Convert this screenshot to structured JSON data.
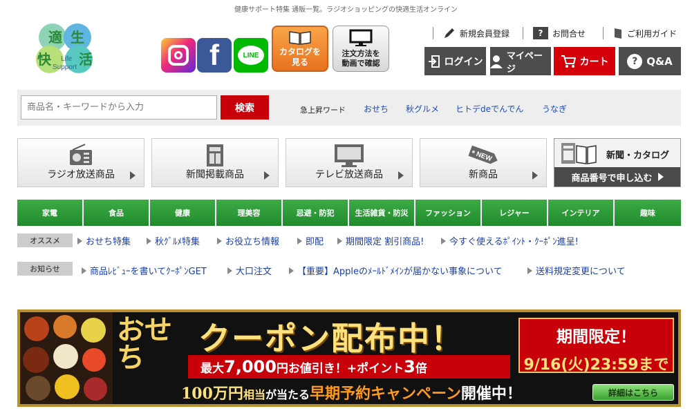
{
  "tagline": "健康サポート特集 通販一覧。ラジオショッピングの快適生活オンライン",
  "logo": {
    "k1": "適",
    "k2": "生",
    "k3": "快",
    "k4": "活",
    "sub1": "Life",
    "sub2": "Support"
  },
  "social": {
    "facebook": "f",
    "line": "LINE"
  },
  "catalog_button": {
    "line1": "カタログを",
    "line2": "見る"
  },
  "order_button": {
    "line1": "注文方法を",
    "line2": "動画で確認"
  },
  "top_links": {
    "register": "新規会員登録",
    "contact": "お問合せ",
    "guide": "ご利用ガイド",
    "help_mark": "?"
  },
  "account_buttons": {
    "login": "ログイン",
    "mypage": "マイページ",
    "cart": "カート",
    "qa": "Q&A",
    "qa_mark": "?"
  },
  "search": {
    "placeholder": "商品名・キーワードから入力",
    "button": "検索",
    "trending_label": "急上昇ワード",
    "trending": [
      "おせち",
      "秋グルメ",
      "ヒトデdeでんでん",
      "うなぎ"
    ]
  },
  "category_tiles": [
    "ラジオ放送商品",
    "新聞掲載商品",
    "テレビ放送商品",
    "新商品"
  ],
  "new_badge": "NEW",
  "order_tile": {
    "top": "新聞・カタログ",
    "bottom": "商品番号で申し込む"
  },
  "green_nav": [
    "家電",
    "食品",
    "健康",
    "理美容",
    "忌避・防犯",
    "生活雑貨・防災",
    "ファッション",
    "レジャー",
    "インテリア",
    "趣味"
  ],
  "recommend": {
    "label": "オススメ",
    "items": [
      "おせち特集",
      "秋ｸﾞﾙﾒ特集",
      "お役立ち情報",
      "即配",
      "期間限定 割引商品!",
      "今すぐ使えるﾎﾟｲﾝﾄ・ｸｰﾎﾟﾝ進呈!"
    ]
  },
  "news": {
    "label": "お知らせ",
    "items": [
      "商品ﾚﾋﾞｭｰを書いてｸｰﾎﾟﾝGET",
      "大口注文",
      "【重要】Appleのﾒｰﾙﾄﾞﾒｲﾝが届かない事象について",
      "送料規定変更について"
    ]
  },
  "banner": {
    "osechi": "おせち",
    "title": "クーポン配布中！",
    "red_pre": "最大",
    "red_big": "7,000",
    "red_post": "円お値引き！+ポイント",
    "red_big2": "3",
    "red_end": "倍",
    "limited_title": "期間限定！",
    "limited_date": "9/16(火)23:59まで",
    "bottom_a": "100万円",
    "bottom_b": "相当",
    "bottom_c": "が当たる",
    "bottom_d": "早期予約キャンペーン",
    "bottom_e": "開催中！",
    "detail": "詳細はこちら"
  },
  "colors": {
    "green_nav": "#1f8a2c",
    "red": "#c8000a",
    "dark_button": "#4d4d4d",
    "link": "#1a3fa8"
  }
}
